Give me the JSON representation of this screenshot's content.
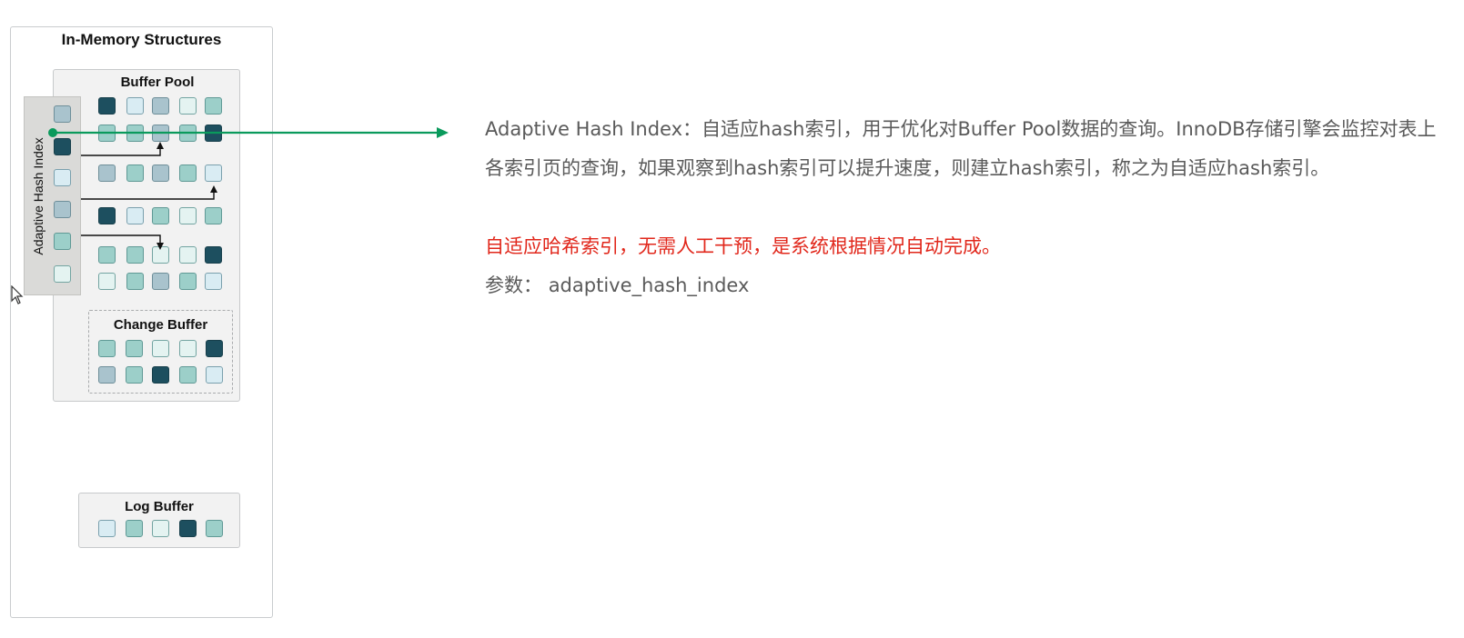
{
  "diagram": {
    "title": "In-Memory Structures",
    "buffer_pool": {
      "title": "Buffer Pool"
    },
    "adaptive_hash_index": {
      "label": "Adaptive Hash Index"
    },
    "change_buffer": {
      "title": "Change Buffer"
    },
    "log_buffer": {
      "title": "Log Buffer"
    }
  },
  "description": {
    "main": "Adaptive Hash Index：自适应hash索引，用于优化对Buffer Pool数据的查询。InnoDB存储引擎会监控对表上各索引页的查询，如果观察到hash索引可以提升速度，则建立hash索引，称之为自适应hash索引。",
    "note": "自适应哈希索引，无需人工干预，是系统根据情况自动完成。",
    "param_label": "参数：",
    "param_value": "adaptive_hash_index"
  },
  "colors": {
    "accent_green": "#0a9a5c",
    "note_red": "#e1271b",
    "page_dark": "#1d4f5f",
    "page_teal": "#9ccfc9",
    "page_grey": "#a9c3cd",
    "page_light": "#d9ecf3",
    "page_pale": "#e4f3f1"
  }
}
